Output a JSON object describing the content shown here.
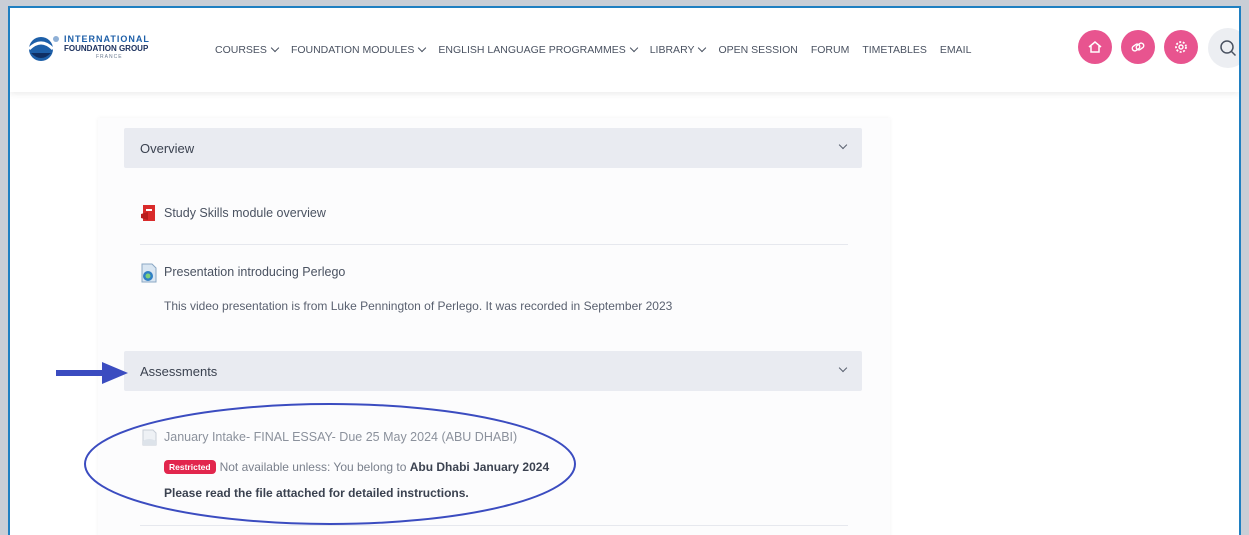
{
  "logo": {
    "line1": "INTERNATIONAL",
    "line2": "FOUNDATION GROUP",
    "line3": "FRANCE"
  },
  "nav": {
    "items": [
      {
        "label": "COURSES",
        "dropdown": true
      },
      {
        "label": "FOUNDATION MODULES",
        "dropdown": true
      },
      {
        "label": "ENGLISH LANGUAGE PROGRAMMES",
        "dropdown": true
      },
      {
        "label": "LIBRARY",
        "dropdown": true
      },
      {
        "label": "OPEN SESSION",
        "dropdown": false
      },
      {
        "label": "FORUM",
        "dropdown": false
      },
      {
        "label": "TIMETABLES",
        "dropdown": false
      },
      {
        "label": "EMAIL",
        "dropdown": false
      }
    ],
    "icon_buttons": [
      "home-icon",
      "link-icon",
      "settings-icon"
    ],
    "search_icon": "search-icon",
    "accent_color": "#e8548f"
  },
  "sections": [
    {
      "title": "Overview",
      "activities": [
        {
          "icon": "pdf-icon",
          "title": "Study Skills module overview"
        },
        {
          "icon": "video-file-icon",
          "title": "Presentation introducing Perlego",
          "description": "This video presentation is from Luke Pennington of Perlego. It was recorded in September 2023"
        }
      ]
    },
    {
      "title": "Assessments",
      "activities": [
        {
          "icon": "assignment-icon",
          "title": "January Intake- FINAL ESSAY- Due 25 May 2024 (ABU DHABI)",
          "restriction_badge": "Restricted",
          "restriction_text": "Not available unless: You belong to",
          "restriction_group": "Abu Dhabi January 2024",
          "instructions": "Please read the file attached for detailed instructions."
        }
      ]
    }
  ],
  "annotations": {
    "arrow_color": "#3b4cc0",
    "ellipse_color": "#3b4cc0"
  }
}
